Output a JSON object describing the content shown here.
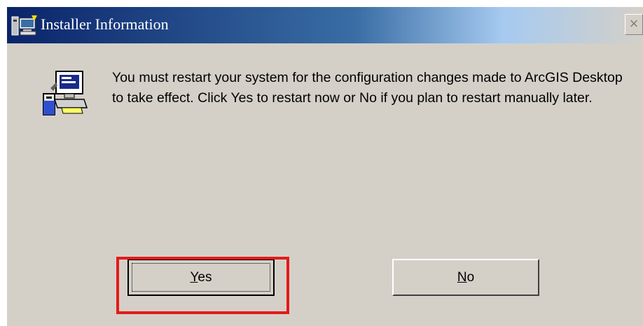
{
  "window": {
    "title": "Installer Information",
    "close_glyph": "×",
    "app_icon": "installer-app-icon"
  },
  "dialog": {
    "icon": "computer-setup-icon",
    "message": "You must restart your system for the configuration changes made to ArcGIS Desktop to take effect. Click Yes to restart now or No if you plan to restart manually later."
  },
  "buttons": {
    "yes": {
      "mnemonic": "Y",
      "rest": "es",
      "focused": true
    },
    "no": {
      "mnemonic": "N",
      "rest": "o"
    }
  },
  "annotation": {
    "highlight_color": "#e31a1a",
    "highlight_target": "yes-button"
  },
  "colors": {
    "dialog_bg": "#d4d0c8",
    "title_gradient_start": "#0a246a"
  }
}
